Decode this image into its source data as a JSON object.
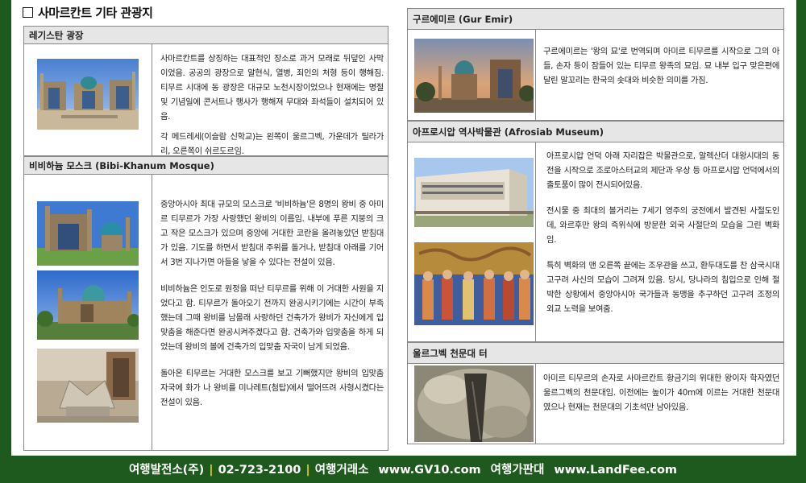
{
  "page_title": "사마르칸트 기타 관광지",
  "sections": {
    "registan": {
      "header": "레기스탄 광장",
      "paragraphs": [
        "사마르칸트를 상징하는 대표적인 장소로 과거 모래로 뒤덮인 사막이었음. 공공의 광장으로 알현식, 열병, 죄인의 처형 등이 행해짐. 티무르 시대에 동 광장은 대규모 노천시장이었으나 현재에는 명절 및 기념일에 콘서트나 행사가 행해져 무대와 좌석들이 설치되어 있음.",
        "각 메드레세(이슬람 신학교)는 왼쪽이 울르그벡, 가운데가 틸라가리, 오른쪽이 쉬르도르임."
      ]
    },
    "bibi": {
      "header": "비비하늄 모스크 (Bibi-Khanum Mosque)",
      "paragraphs": [
        "중앙아시아 최대 규모의 모스크로 '비비하늄'은 8명의 왕비 중 아미르 티무르가 가장 사랑했던 왕비의 이름임. 내부에 푸른 지붕의 크고 작은 모스크가 있으며 중앙에 거대한 코란을 올려놓았던 받침대가 있음. 기도를 하면서 받침대 주위를 돌거나, 받침대 아래를 기어서 3번 지나가면 아들을 낳을 수 있다는 전설이 있음.",
        "비비하늄은 인도로 원정을 떠난 티무르를 위해 이 거대한 사원을 지었다고 함. 티무르가 돌아오기 전까지 완공시키기에는 시간이 부족했는데 그때 왕비를 남몰래 사랑하던 건축가가 왕비가 자신에게 입맞춤을 해준다면 완공시켜주겠다고 함. 건축가와 입맞춤을 하게 되었는데 왕비의 볼에 건축가의 입맞춤 자국이 남게 되었음.",
        "돌아온 티무르는 거대한 모스크를 보고 기뻐했지만 왕비의 입맞춤 자국에 화가 나 왕비를 미나레트(첨탑)에서 떨어뜨려 사형시켰다는 전설이 있음."
      ]
    },
    "gur": {
      "header": "구르에미르 (Gur Emir)",
      "paragraphs": [
        "구르에미르는 '왕의 묘'로 번역되며 아미르 티무르를 시작으로 그의 아들, 손자 등이 잠들어 있는 티무르 왕족의 묘임. 묘 내부 입구 맞은편에 달린 말꼬리는 한국의 솟대와 비슷한 의미를 가짐."
      ]
    },
    "afro": {
      "header": "아프로시압 역사박물관 (Afrosiab Museum)",
      "paragraphs": [
        "아프로시압 언덕 아래 자리잡은 박물관으로, 알렉산더 대왕시대의 동전을 시작으로 조로아스터교의 제단과 우상 등 아프로시압 언덕에서의 출토품이 많이 전시되어있음.",
        "전시물 중 최대의 볼거리는 7세기 영주의 궁전에서 발견된 사절도인데, 와르후만 왕의 즉위식에 방문한 외국 사절단의 모습을 그린 벽화임.",
        "특히 벽화의 맨 오른쪽 끝에는 조우관을 쓰고, 환두대도를 찬 삼국시대 고구려 사신의 모습이 그려져 있음. 당시, 당나라의 침입으로 인해 절박한 상황에서 중앙아시아 국가들과 동맹을 추구하던 고구려 조정의 외교 노력을 보여줌."
      ]
    },
    "ulugh": {
      "header": "울르그벡 천문대 터",
      "paragraphs": [
        "아미르 티무르의 손자로 사마르칸트 황금기의 위대한 왕이자 학자였던 울르그벡의 천문대임. 이전에는 높이가 40m에 이르는 거대한 천문대였으나 현재는 천문대의 기초석만 남아있음."
      ]
    }
  },
  "footer": {
    "company": "여행발전소(주)",
    "phone": "02-723-2100",
    "exchange_label": "여행거래소",
    "exchange_url": "www.GV10.com",
    "market_label": "여행가판대",
    "market_url": "www.LandFee.com"
  },
  "colors": {
    "background_green": "#1e5a1e",
    "header_gray": "#e6e6e6",
    "footer_separator": "#f0d000"
  }
}
